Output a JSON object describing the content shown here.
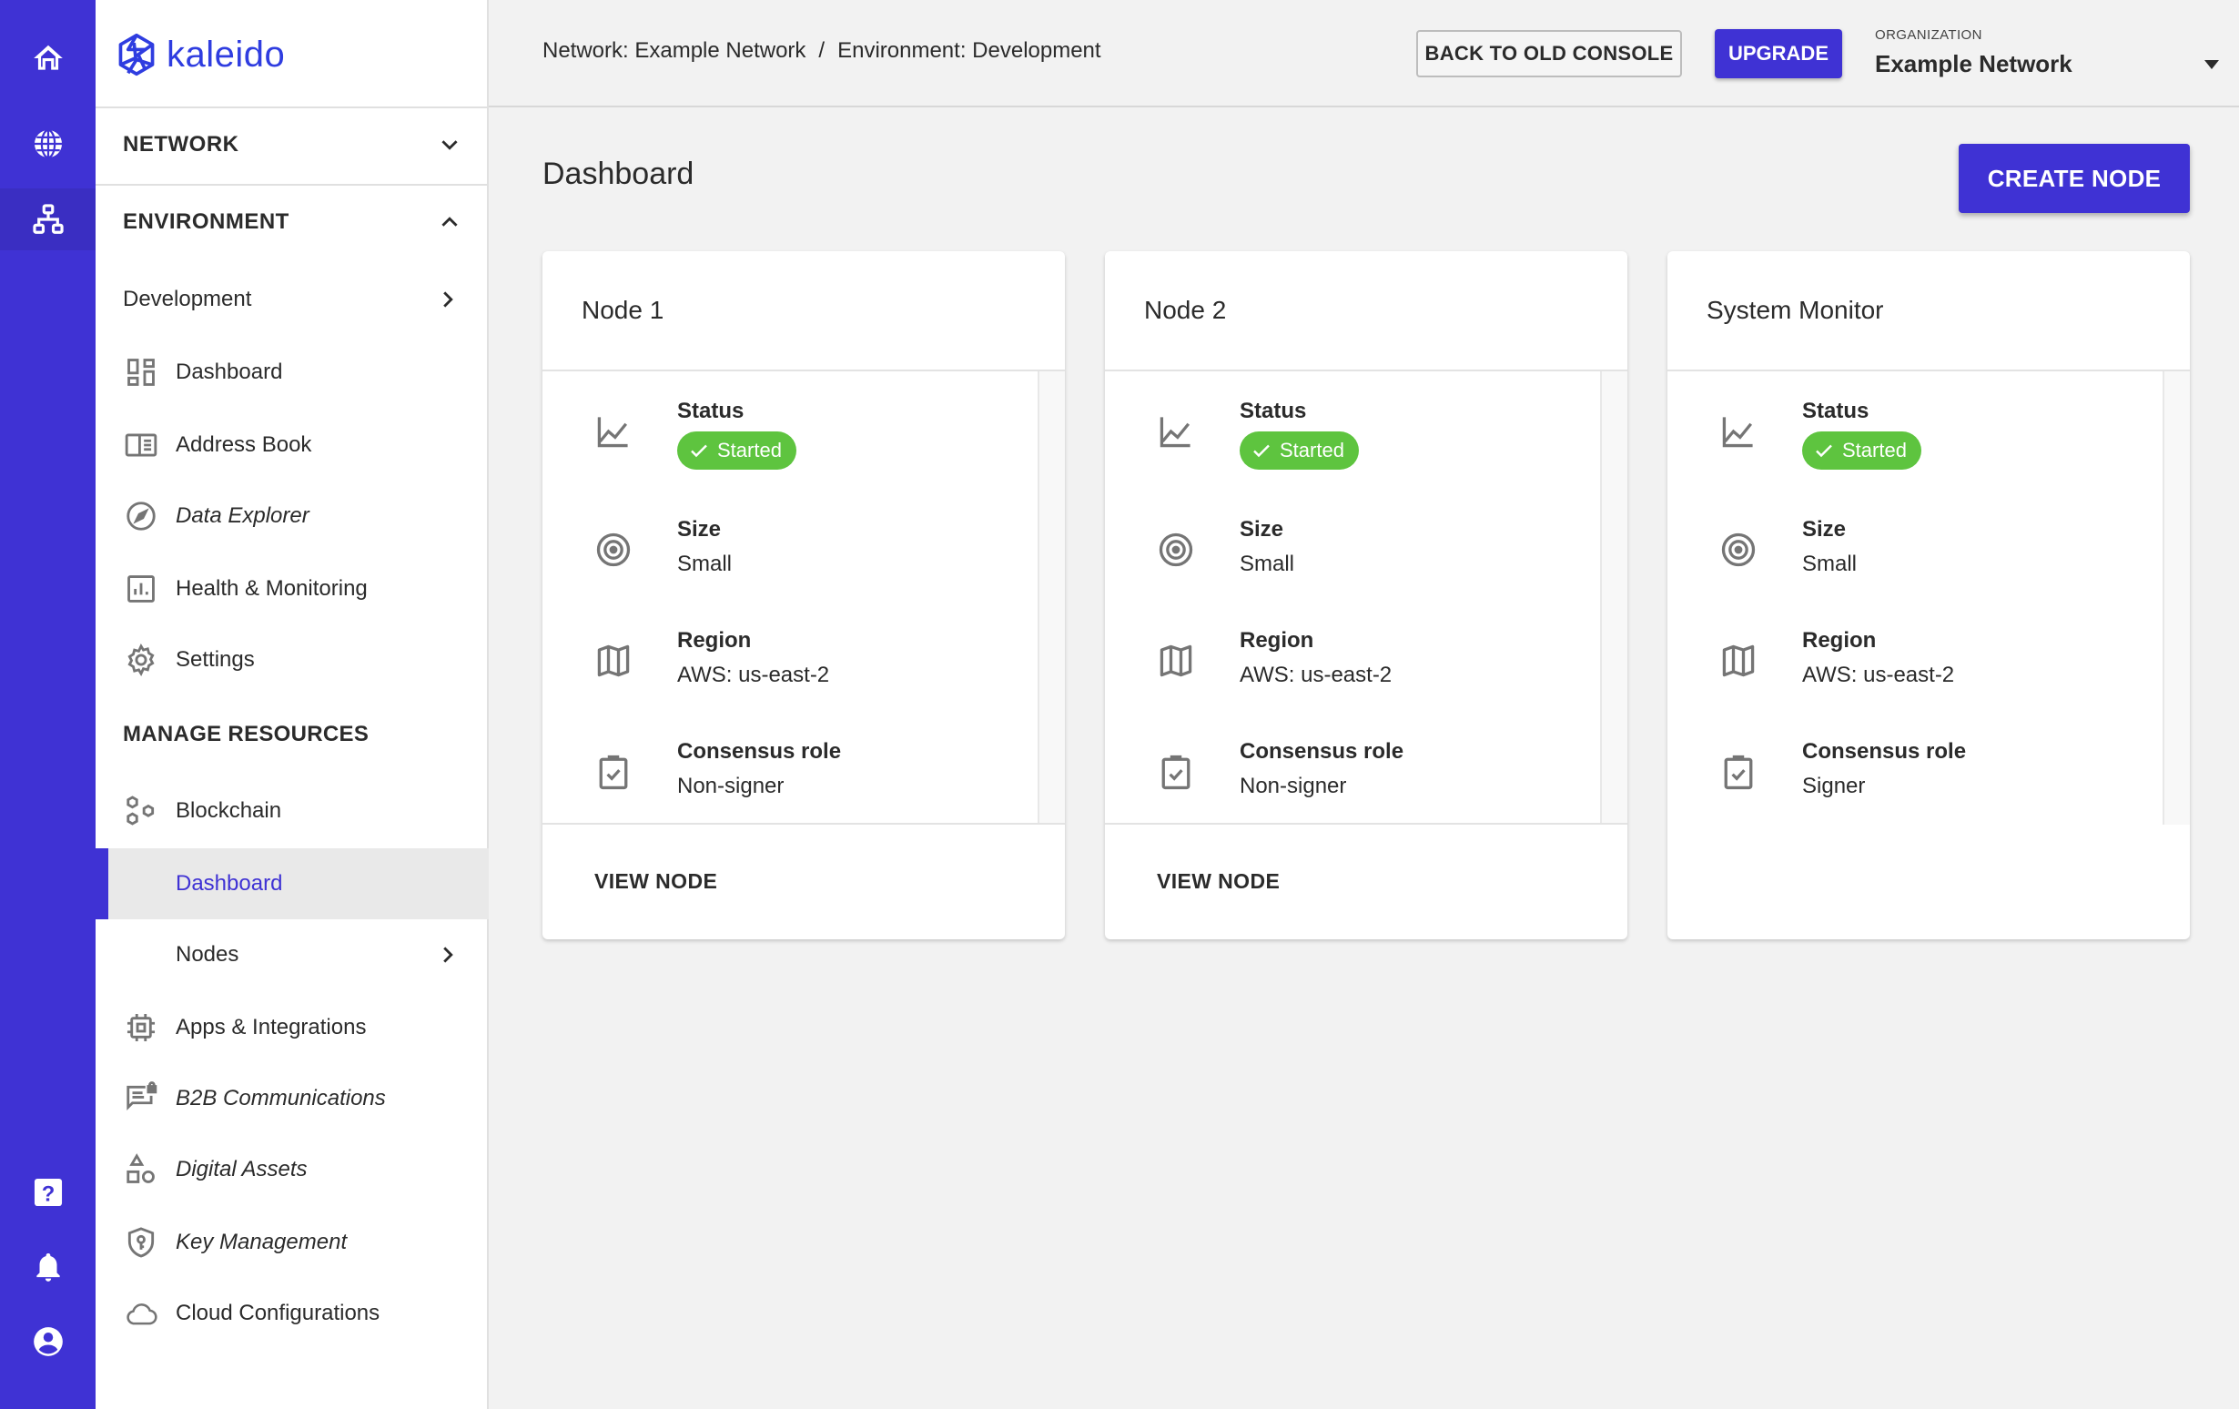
{
  "rail": {
    "top_items": [
      {
        "name": "home",
        "icon": "home-icon"
      },
      {
        "name": "network",
        "icon": "globe-icon"
      },
      {
        "name": "environment",
        "icon": "sitemap-icon",
        "active": true
      }
    ],
    "bottom_items": [
      {
        "name": "help",
        "icon": "help-icon"
      },
      {
        "name": "notifications",
        "icon": "bell-icon"
      },
      {
        "name": "account",
        "icon": "account-circle-icon"
      }
    ]
  },
  "brand": {
    "name": "kaleido",
    "color": "#2f3de0"
  },
  "sidebar": {
    "network_label": "NETWORK",
    "environment_label": "ENVIRONMENT",
    "environment_items": [
      {
        "label": "Development",
        "icon": null,
        "chevron": true
      },
      {
        "label": "Dashboard",
        "icon": "dashboard-icon"
      },
      {
        "label": "Address Book",
        "icon": "address-book-icon"
      },
      {
        "label": "Data Explorer",
        "icon": "compass-icon",
        "italic": true
      },
      {
        "label": "Health & Monitoring",
        "icon": "bar-chart-icon"
      },
      {
        "label": "Settings",
        "icon": "gear-icon"
      }
    ],
    "manage_resources_label": "MANAGE RESOURCES",
    "resource_items": [
      {
        "label": "Blockchain",
        "icon": "hexagons-icon"
      },
      {
        "label": "Dashboard",
        "icon": null,
        "active": true
      },
      {
        "label": "Nodes",
        "icon": null,
        "chevron": true
      },
      {
        "label": "Apps & Integrations",
        "icon": "chip-icon"
      },
      {
        "label": "B2B Communications",
        "icon": "secure-chat-icon",
        "italic": true
      },
      {
        "label": "Digital Assets",
        "icon": "shapes-icon",
        "italic": true
      },
      {
        "label": "Key Management",
        "icon": "key-shield-icon",
        "italic": true
      },
      {
        "label": "Cloud Configurations",
        "icon": "cloud-icon"
      }
    ]
  },
  "header": {
    "breadcrumb": [
      "Network: Example Network",
      "/",
      "Environment: Development"
    ],
    "back_button": "BACK TO OLD CONSOLE",
    "upgrade_button": "UPGRADE",
    "org_label": "ORGANIZATION",
    "org_value": "Example Network"
  },
  "main": {
    "title": "Dashboard",
    "create_button": "CREATE NODE",
    "cards": [
      {
        "title": "Node 1",
        "status_label": "Status",
        "status": "Started",
        "size_label": "Size",
        "size": "Small",
        "region_label": "Region",
        "region": "AWS: us-east-2",
        "role_label": "Consensus role",
        "role": "Non-signer",
        "action": "VIEW NODE"
      },
      {
        "title": "Node 2",
        "status_label": "Status",
        "status": "Started",
        "size_label": "Size",
        "size": "Small",
        "region_label": "Region",
        "region": "AWS: us-east-2",
        "role_label": "Consensus role",
        "role": "Non-signer",
        "action": "VIEW NODE"
      },
      {
        "title": "System Monitor",
        "status_label": "Status",
        "status": "Started",
        "size_label": "Size",
        "size": "Small",
        "region_label": "Region",
        "region": "AWS: us-east-2",
        "role_label": "Consensus role",
        "role": "Signer"
      }
    ]
  },
  "colors": {
    "primary": "#3f32d4",
    "success": "#5ec43f",
    "background": "#f2f2f2"
  }
}
